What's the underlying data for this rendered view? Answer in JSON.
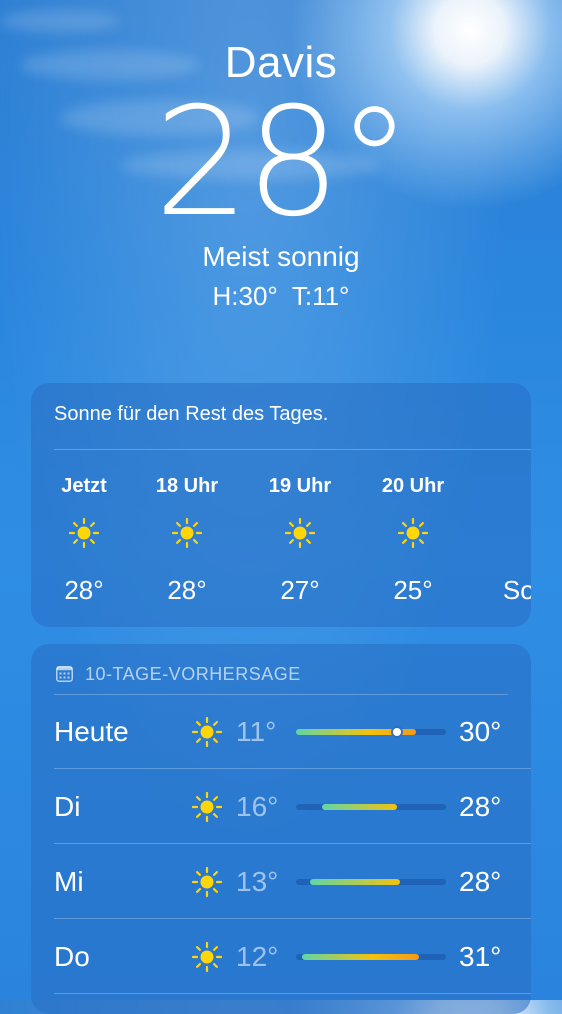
{
  "location": {
    "city": "Davis",
    "temperature": "28°",
    "condition": "Meist sonnig",
    "high": "H:30°",
    "low": "T:11°"
  },
  "hourly": {
    "summary": "Sonne für den Rest des Tages.",
    "items": [
      {
        "time": "Jetzt",
        "icon": "sun-icon",
        "temp": "28°"
      },
      {
        "time": "18 Uhr",
        "icon": "sun-icon",
        "temp": "28°"
      },
      {
        "time": "19 Uhr",
        "icon": "sun-icon",
        "temp": "27°"
      },
      {
        "time": "20 Uhr",
        "icon": "sun-icon",
        "temp": "25°"
      },
      {
        "time": "",
        "icon": "",
        "temp": "Son"
      }
    ]
  },
  "daily": {
    "title": "10-TAGE-VORHERSAGE",
    "icon": "calendar-icon",
    "days": [
      {
        "day": "Heute",
        "icon": "sun-icon",
        "low": "11°",
        "high": "30°",
        "range": [
          0.0,
          0.8
        ],
        "current": 0.67
      },
      {
        "day": "Di",
        "icon": "sun-icon",
        "low": "16°",
        "high": "28°",
        "range": [
          0.17,
          0.67
        ]
      },
      {
        "day": "Mi",
        "icon": "sun-icon",
        "low": "13°",
        "high": "28°",
        "range": [
          0.09,
          0.69
        ]
      },
      {
        "day": "Do",
        "icon": "sun-icon",
        "low": "12°",
        "high": "31°",
        "range": [
          0.04,
          0.82
        ]
      }
    ]
  },
  "colors": {
    "sun": "#ffd60a",
    "cool": "#5fd6a8",
    "warm": "#f4c20d",
    "hot": "#f39a1c"
  }
}
